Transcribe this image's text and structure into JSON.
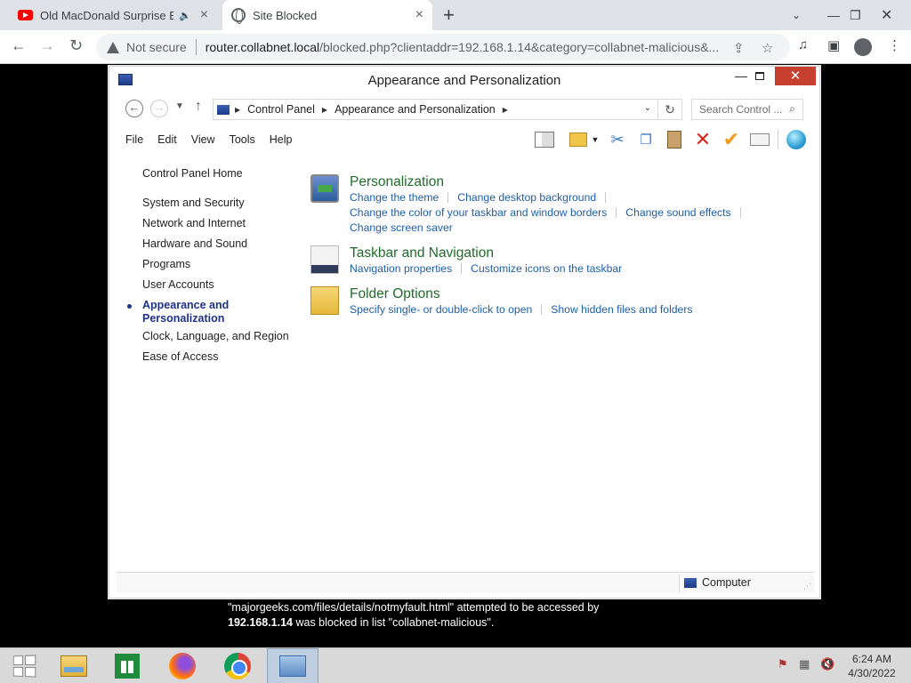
{
  "browser": {
    "tabs": [
      {
        "title": "Old MacDonald Surprise Eggs",
        "audio": true
      },
      {
        "title": "Site Blocked"
      }
    ],
    "new_tab_symbol": "+",
    "security_label": "Not secure",
    "url_host": "router.collabnet.local",
    "url_rest": "/blocked.php?clientaddr=192.168.1.14&category=collabnet-malicious&...",
    "colors": {
      "tabbar": "#dee1e6",
      "youtube": "#ff0000"
    }
  },
  "window": {
    "title": "Appearance and Personalization",
    "close_symbol": "✕",
    "min_symbol": "—",
    "breadcrumb": [
      "Control Panel",
      "Appearance and Personalization"
    ],
    "search_placeholder": "Search Control ...",
    "menu": [
      "File",
      "Edit",
      "View",
      "Tools",
      "Help"
    ],
    "status_text": "Computer",
    "colors": {
      "close": "#c7402f",
      "category_heading": "#1e6c2a",
      "link": "#1e5ea8",
      "active_nav": "#1e3287"
    }
  },
  "left_nav": {
    "home": "Control Panel Home",
    "items": [
      "System and Security",
      "Network and Internet",
      "Hardware and Sound",
      "Programs",
      "User Accounts",
      "Appearance and Personalization",
      "Clock, Language, and Region",
      "Ease of Access"
    ],
    "active_line1": "Appearance and",
    "active_line2": "Personalization"
  },
  "categories": [
    {
      "heading": "Personalization",
      "icon": "personalization-icon",
      "links": [
        "Change the theme",
        "Change desktop background",
        "Change the color of your taskbar and window borders",
        "Change sound effects",
        "Change screen saver"
      ]
    },
    {
      "heading": "Taskbar and Navigation",
      "icon": "taskbar-icon",
      "links": [
        "Navigation properties",
        "Customize icons on the taskbar"
      ]
    },
    {
      "heading": "Folder Options",
      "icon": "folder-options-icon",
      "links": [
        "Specify single- or double-click to open",
        "Show hidden files and folders"
      ]
    }
  ],
  "blocked_message": {
    "line1": "\"majorgeeks.com/files/details/notmyfault.html\" attempted to be accessed by",
    "ip": "192.168.1.14",
    "line2_rest": " was blocked in list \"collabnet-malicious\"."
  },
  "taskbar": {
    "apps": [
      "start-button",
      "file-explorer",
      "store",
      "firefox",
      "chrome",
      "control-panel"
    ],
    "time": "6:24 AM",
    "date": "4/30/2022"
  }
}
